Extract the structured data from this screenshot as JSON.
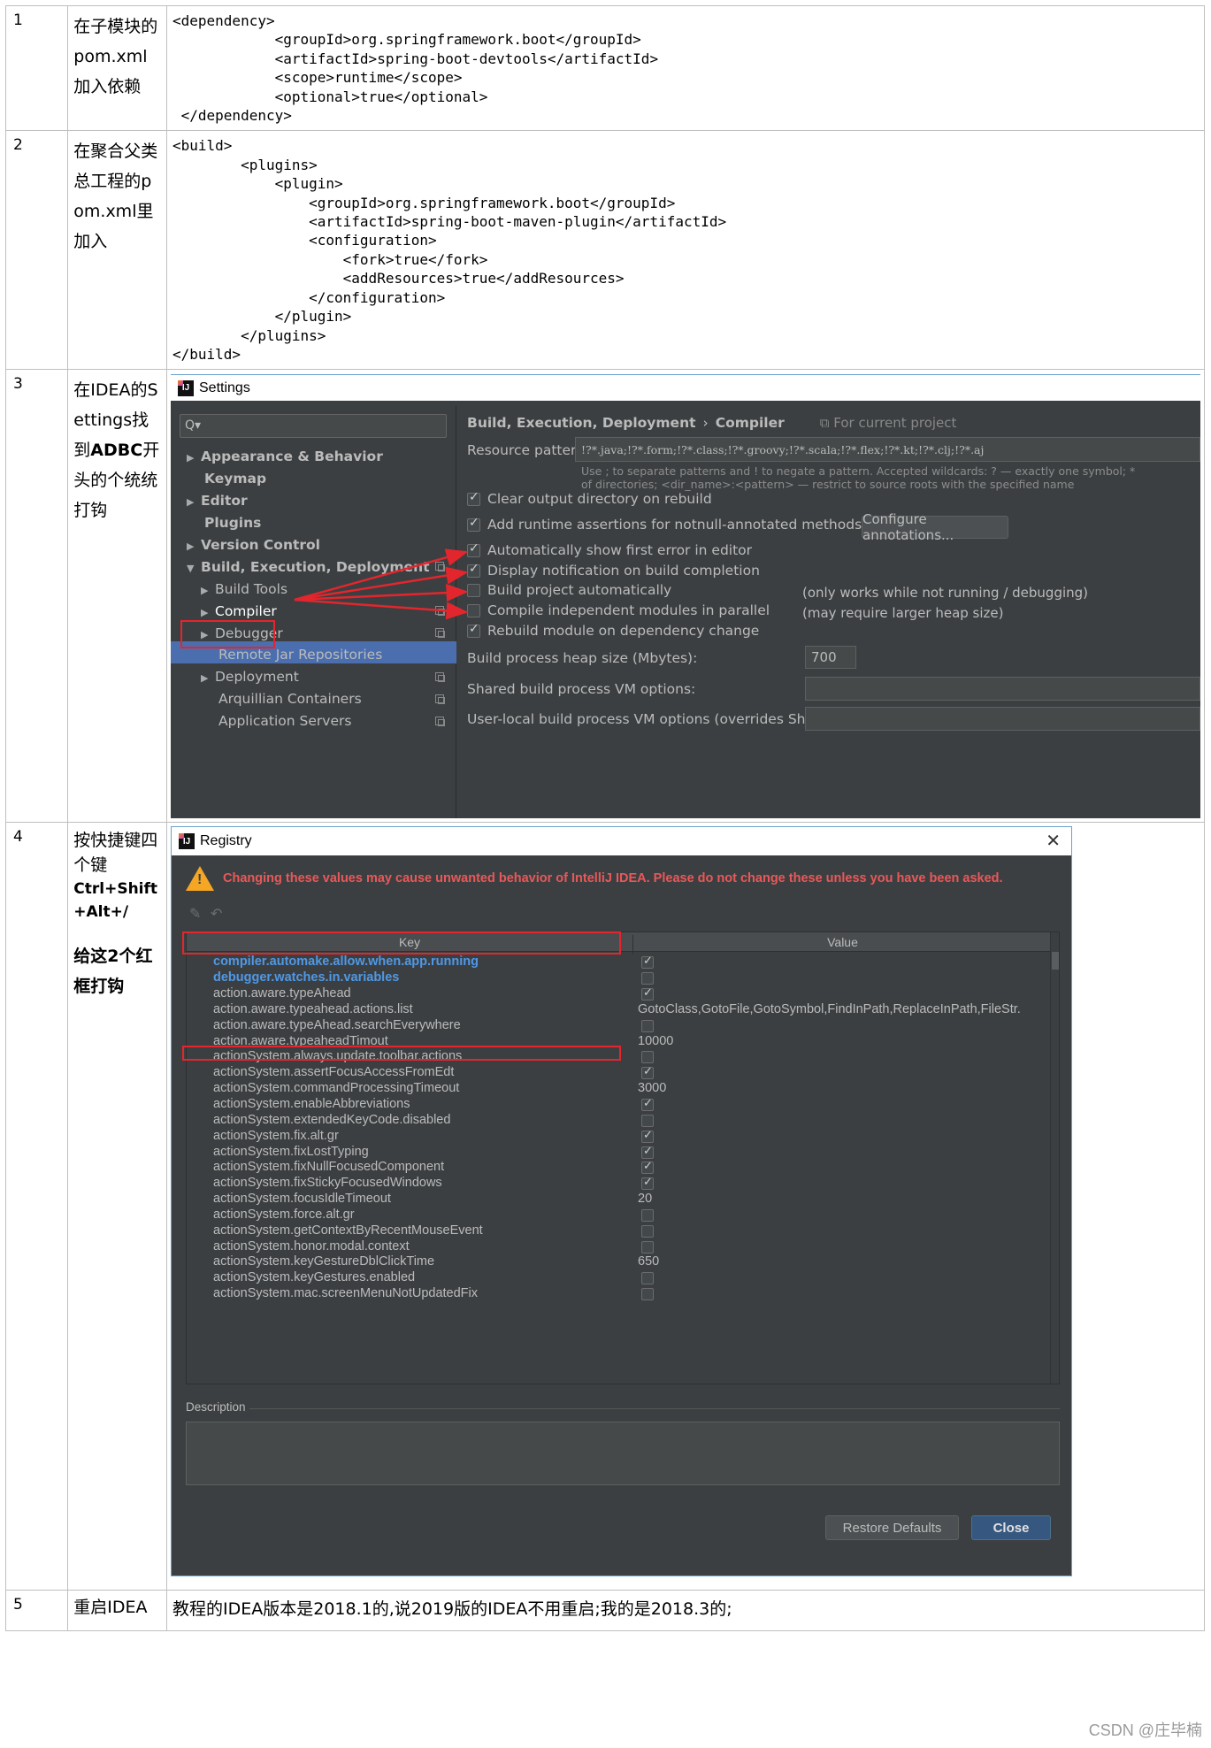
{
  "rows": [
    {
      "num": "1",
      "desc": "在子模块的pom.xml加入依赖",
      "code": "<dependency>\n            <groupId>org.springframework.boot</groupId>\n            <artifactId>spring-boot-devtools</artifactId>\n            <scope>runtime</scope>\n            <optional>true</optional>\n </dependency>"
    },
    {
      "num": "2",
      "desc": "在聚合父类总工程的pom.xml里加入",
      "code": "<build>\n        <plugins>\n            <plugin>\n                <groupId>org.springframework.boot</groupId>\n                <artifactId>spring-boot-maven-plugin</artifactId>\n                <configuration>\n                    <fork>true</fork>\n                    <addResources>true</addResources>\n                </configuration>\n            </plugin>\n        </plugins>\n</build>"
    },
    {
      "num": "3",
      "desc_a": "在IDEA的Settings找到",
      "desc_b": "ADBC",
      "desc_c": "开头的个统统打钩"
    },
    {
      "num": "4",
      "desc_a": "按快捷键四个键",
      "desc_b": "Ctrl+Shift+Alt+/",
      "desc_c": "给这2个红框打钩"
    },
    {
      "num": "5",
      "desc": "重启IDEA",
      "text": "教程的IDEA版本是2018.1的,说2019版的IDEA不用重启;我的是2018.3的;"
    }
  ],
  "settings": {
    "title": "Settings",
    "search_glyph": "Q▾",
    "tree": [
      {
        "label": "Appearance & Behavior",
        "arrow": "▶",
        "bold": true
      },
      {
        "label": "Keymap",
        "arrow": "",
        "bold": true
      },
      {
        "label": "Editor",
        "arrow": "▶",
        "bold": true
      },
      {
        "label": "Plugins",
        "arrow": "",
        "bold": true
      },
      {
        "label": "Version Control",
        "arrow": "▶",
        "bold": true
      },
      {
        "label": "Build, Execution, Deployment",
        "arrow": "▼",
        "bold": true
      },
      {
        "label": "Build Tools",
        "arrow": "▶",
        "bold": false
      },
      {
        "label": "Compiler",
        "arrow": "▶",
        "bold": false
      },
      {
        "label": "Debugger",
        "arrow": "▶",
        "bold": false
      },
      {
        "label": "Remote Jar Repositories",
        "arrow": "",
        "bold": false
      },
      {
        "label": "Deployment",
        "arrow": "▶",
        "bold": false
      },
      {
        "label": "Arquillian Containers",
        "arrow": "",
        "bold": false
      },
      {
        "label": "Application Servers",
        "arrow": "",
        "bold": false
      }
    ],
    "breadcrumb": {
      "section": "Build, Execution, Deployment",
      "sep": "›",
      "page": "Compiler",
      "scope": "⧉ For current project"
    },
    "resource_label": "Resource patterns:",
    "resource_value": "!?*.java;!?*.form;!?*.class;!?*.groovy;!?*.scala;!?*.flex;!?*.kt;!?*.clj;!?*.aj",
    "hint1": "Use ; to separate patterns and ! to negate a pattern. Accepted wildcards: ? — exactly one symbol; *",
    "hint2": "of directories; <dir_name>:<pattern> — restrict to source roots with the specified name",
    "checkboxes": [
      {
        "label": "Clear output directory on rebuild",
        "checked": true
      },
      {
        "label": "Add runtime assertions for notnull-annotated methods and parameters",
        "checked": true
      },
      {
        "label": "Automatically show first error in editor",
        "checked": true
      },
      {
        "label": "Display notification on build completion",
        "checked": true
      },
      {
        "label": "Build project automatically",
        "checked": false
      },
      {
        "label": "Compile independent modules in parallel",
        "checked": false
      },
      {
        "label": "Rebuild module on dependency change",
        "checked": true
      }
    ],
    "configure_button": "Configure annotations...",
    "note_build": "(only works while not running / debugging)",
    "note_parallel": "(may require larger heap size)",
    "heap_label": "Build process heap size (Mbytes):",
    "heap_value": "700",
    "shared_label": "Shared build process VM options:",
    "userlocal_label": "User-local build process VM options (overrides Shared options):"
  },
  "registry": {
    "title": "Registry",
    "close_glyph": "✕",
    "warning": "Changing these values may cause unwanted behavior of IntelliJ IDEA. Please do not change these unless you have been asked.",
    "col_key": "Key",
    "col_value": "Value",
    "rows": [
      {
        "key": "compiler.automake.allow.when.app.running",
        "value": "",
        "checkbox": true,
        "checked": true,
        "blue": true
      },
      {
        "key": "debugger.watches.in.variables",
        "value": "",
        "checkbox": true,
        "checked": false,
        "blue": true
      },
      {
        "key": "action.aware.typeAhead",
        "value": "",
        "checkbox": true,
        "checked": true,
        "blue": false
      },
      {
        "key": "action.aware.typeahead.actions.list",
        "value": "GotoClass,GotoFile,GotoSymbol,FindInPath,ReplaceInPath,FileStr.",
        "checkbox": false,
        "checked": false,
        "blue": false
      },
      {
        "key": "action.aware.typeAhead.searchEverywhere",
        "value": "",
        "checkbox": true,
        "checked": false,
        "blue": false
      },
      {
        "key": "action.aware.typeaheadTimout",
        "value": "10000",
        "checkbox": false,
        "checked": false,
        "blue": false
      },
      {
        "key": "actionSystem.always.update.toolbar.actions",
        "value": "",
        "checkbox": true,
        "checked": false,
        "blue": false
      },
      {
        "key": "actionSystem.assertFocusAccessFromEdt",
        "value": "",
        "checkbox": true,
        "checked": true,
        "blue": false
      },
      {
        "key": "actionSystem.commandProcessingTimeout",
        "value": "3000",
        "checkbox": false,
        "checked": false,
        "blue": false
      },
      {
        "key": "actionSystem.enableAbbreviations",
        "value": "",
        "checkbox": true,
        "checked": true,
        "blue": false
      },
      {
        "key": "actionSystem.extendedKeyCode.disabled",
        "value": "",
        "checkbox": true,
        "checked": false,
        "blue": false
      },
      {
        "key": "actionSystem.fix.alt.gr",
        "value": "",
        "checkbox": true,
        "checked": true,
        "blue": false
      },
      {
        "key": "actionSystem.fixLostTyping",
        "value": "",
        "checkbox": true,
        "checked": true,
        "blue": false
      },
      {
        "key": "actionSystem.fixNullFocusedComponent",
        "value": "",
        "checkbox": true,
        "checked": true,
        "blue": false
      },
      {
        "key": "actionSystem.fixStickyFocusedWindows",
        "value": "",
        "checkbox": true,
        "checked": true,
        "blue": false
      },
      {
        "key": "actionSystem.focusIdleTimeout",
        "value": "20",
        "checkbox": false,
        "checked": false,
        "blue": false
      },
      {
        "key": "actionSystem.force.alt.gr",
        "value": "",
        "checkbox": true,
        "checked": false,
        "blue": false
      },
      {
        "key": "actionSystem.getContextByRecentMouseEvent",
        "value": "",
        "checkbox": true,
        "checked": false,
        "blue": false
      },
      {
        "key": "actionSystem.honor.modal.context",
        "value": "",
        "checkbox": true,
        "checked": false,
        "blue": false
      },
      {
        "key": "actionSystem.keyGestureDblClickTime",
        "value": "650",
        "checkbox": false,
        "checked": false,
        "blue": false
      },
      {
        "key": "actionSystem.keyGestures.enabled",
        "value": "",
        "checkbox": true,
        "checked": false,
        "blue": false
      },
      {
        "key": "actionSystem.mac.screenMenuNotUpdatedFix",
        "value": "",
        "checkbox": true,
        "checked": false,
        "blue": false
      }
    ],
    "description_label": "Description",
    "restore_button": "Restore Defaults",
    "close_button": "Close"
  },
  "watermark": "CSDN @庄毕楠",
  "colors": {
    "highlight_red": "#e3262d",
    "ide_background": "#3c3f41",
    "selection_blue": "#4b6eaf",
    "registry_key_blue": "#4f98e6",
    "warning_red": "#e8585a"
  }
}
